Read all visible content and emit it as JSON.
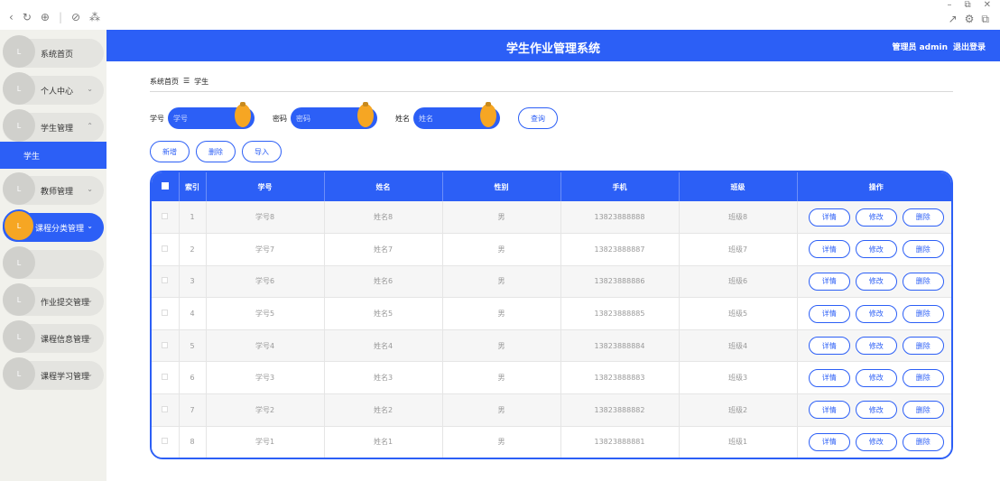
{
  "chrome": {
    "back": "‹",
    "refresh": "↻",
    "globe": "⊕",
    "link": "⊘",
    "grid": "⁂",
    "minimize": "–",
    "maximize": "⧉",
    "close": "✕",
    "share": "↗",
    "ext": "⚙",
    "copy": "⧉"
  },
  "header": {
    "title": "学生作业管理系统",
    "user": "管理员 admin",
    "logout": "退出登录"
  },
  "sidebar": {
    "items": [
      {
        "label": "系统首页",
        "chev": ""
      },
      {
        "label": "个人中心",
        "chev": "⌄"
      },
      {
        "label": "学生管理",
        "chev": "⌃"
      },
      {
        "label": "教师管理",
        "chev": "⌄"
      },
      {
        "label": "课程分类管理",
        "chev": "⌄"
      },
      {
        "label": "",
        "chev": ""
      },
      {
        "label": "作业提交管理",
        "chev": "⌄"
      },
      {
        "label": "课程信息管理",
        "chev": "⌄"
      },
      {
        "label": "课程学习管理",
        "chev": "⌄"
      }
    ],
    "sub_item": "学生",
    "knob_glyph": "L"
  },
  "breadcrumb": {
    "home": "系统首页",
    "sep": "☰",
    "current": "学生"
  },
  "search": {
    "id_label": "学号",
    "id_placeholder": "学号",
    "pwd_label": "密码",
    "pwd_placeholder": "密码",
    "name_label": "姓名",
    "name_placeholder": "姓名",
    "query": "查询"
  },
  "actions": {
    "add": "新增",
    "delete": "删除",
    "import": "导入"
  },
  "table": {
    "columns": [
      "索引",
      "学号",
      "姓名",
      "性别",
      "手机",
      "班级",
      "操作"
    ],
    "op_labels": {
      "detail": "详情",
      "edit": "修改",
      "delete": "删除"
    },
    "rows": [
      {
        "index": "1",
        "id": "学号8",
        "name": "姓名8",
        "gender": "男",
        "phone": "13823888888",
        "class": "班级8"
      },
      {
        "index": "2",
        "id": "学号7",
        "name": "姓名7",
        "gender": "男",
        "phone": "13823888887",
        "class": "班级7"
      },
      {
        "index": "3",
        "id": "学号6",
        "name": "姓名6",
        "gender": "男",
        "phone": "13823888886",
        "class": "班级6"
      },
      {
        "index": "4",
        "id": "学号5",
        "name": "姓名5",
        "gender": "男",
        "phone": "13823888885",
        "class": "班级5"
      },
      {
        "index": "5",
        "id": "学号4",
        "name": "姓名4",
        "gender": "男",
        "phone": "13823888884",
        "class": "班级4"
      },
      {
        "index": "6",
        "id": "学号3",
        "name": "姓名3",
        "gender": "男",
        "phone": "13823888883",
        "class": "班级3"
      },
      {
        "index": "7",
        "id": "学号2",
        "name": "姓名2",
        "gender": "男",
        "phone": "13823888882",
        "class": "班级2"
      },
      {
        "index": "8",
        "id": "学号1",
        "name": "姓名1",
        "gender": "男",
        "phone": "13823888881",
        "class": "班级1"
      }
    ]
  },
  "colors": {
    "primary": "#2c5ff6",
    "accent": "#f6a623",
    "sidebar_bg": "#f1f1ec"
  }
}
